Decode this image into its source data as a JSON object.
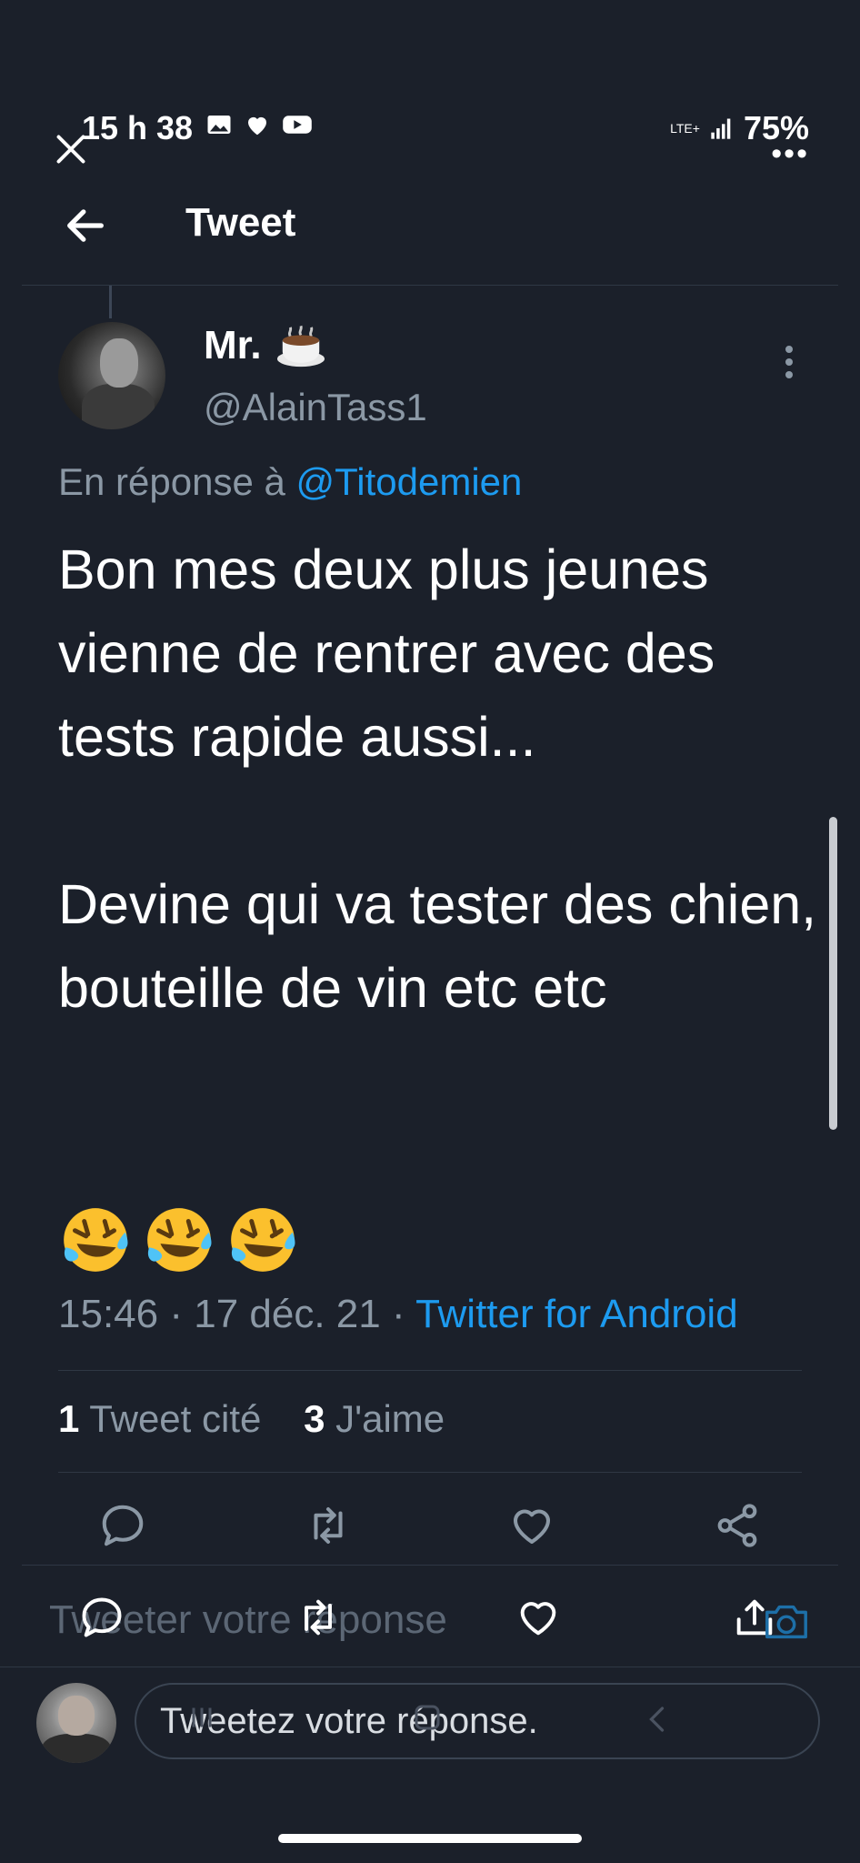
{
  "status_bar": {
    "time": "15 h 38",
    "network": "LTE+",
    "battery": "75%"
  },
  "header": {
    "title": "Tweet"
  },
  "tweet": {
    "display_name": "Mr.",
    "name_emoji": "coffee-cup-icon",
    "handle": "@AlainTass1",
    "reply_prefix": "En réponse à",
    "reply_mention": "@Titodemien",
    "text": "Bon mes deux plus jeunes vienne de rentrer avec des tests rapide aussi...\n\nDevine qui va tester des chien, bouteille de vin etc etc\n\n",
    "emojis": [
      "rofl-emoji",
      "rofl-emoji",
      "rofl-emoji"
    ],
    "time": "15:46",
    "separator": "·",
    "date": "17 déc. 21",
    "source": "Twitter for Android"
  },
  "stats": {
    "quotes_count": "1",
    "quotes_label": "Tweet cité",
    "likes_count": "3",
    "likes_label": "J'aime"
  },
  "actions": [
    "reply-icon",
    "retweet-icon",
    "like-icon",
    "share-icon"
  ],
  "compose": {
    "ghost_label": "Tweeter votre réponse",
    "placeholder": "Tweetez votre réponse."
  },
  "colors": {
    "background": "#1b202a",
    "accent": "#1d9bf0",
    "muted_text": "#8b98a5",
    "divider": "#2f3744"
  }
}
